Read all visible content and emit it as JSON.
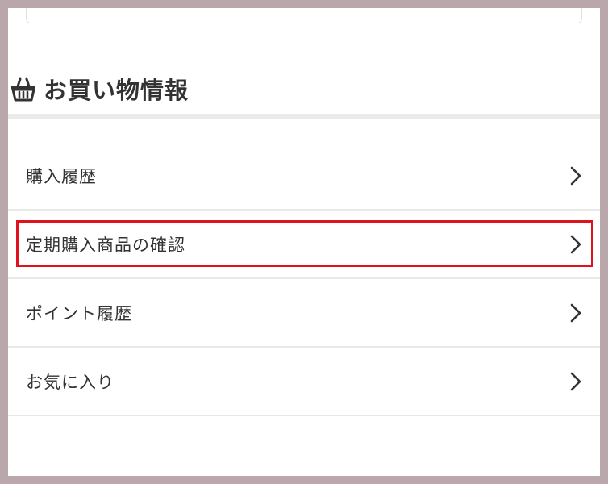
{
  "section": {
    "title": "お買い物情報",
    "icon": "shopping-basket-icon"
  },
  "menu": {
    "items": [
      {
        "label": "購入履歴",
        "icon": "chevron-right-icon"
      },
      {
        "label": "定期購入商品の確認",
        "icon": "chevron-right-icon",
        "highlighted": true
      },
      {
        "label": "ポイント履歴",
        "icon": "chevron-right-icon"
      },
      {
        "label": "お気に入り",
        "icon": "chevron-right-icon"
      }
    ]
  },
  "colors": {
    "highlight": "#e0121b",
    "text": "#333333",
    "divider": "#e8e8e8",
    "background": "#b9a7ab"
  }
}
